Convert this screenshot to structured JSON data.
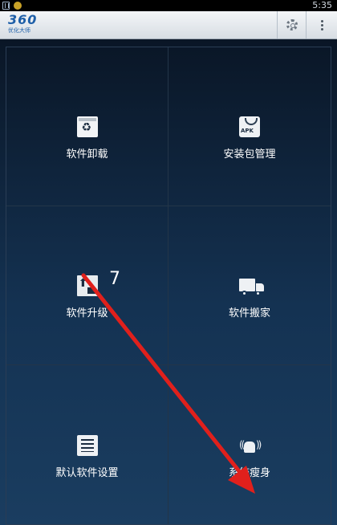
{
  "status_bar": {
    "time": "5:35"
  },
  "app_bar": {
    "logo_number": "360",
    "logo_subtitle": "优化大师",
    "settings_icon": "gear-icon",
    "menu_icon": "overflow-menu-icon"
  },
  "tiles": [
    {
      "label": "软件卸载",
      "icon": "recycle-bin-icon"
    },
    {
      "label": "安装包管理",
      "icon": "apk-package-icon"
    },
    {
      "label": "软件升级",
      "icon": "upgrade-icon",
      "badge": "7"
    },
    {
      "label": "软件搬家",
      "icon": "truck-icon"
    },
    {
      "label": "默认软件设置",
      "icon": "list-settings-icon"
    },
    {
      "label": "系统瘦身",
      "icon": "android-slim-icon"
    }
  ],
  "annotation": {
    "color": "#e0201c",
    "type": "arrow"
  }
}
